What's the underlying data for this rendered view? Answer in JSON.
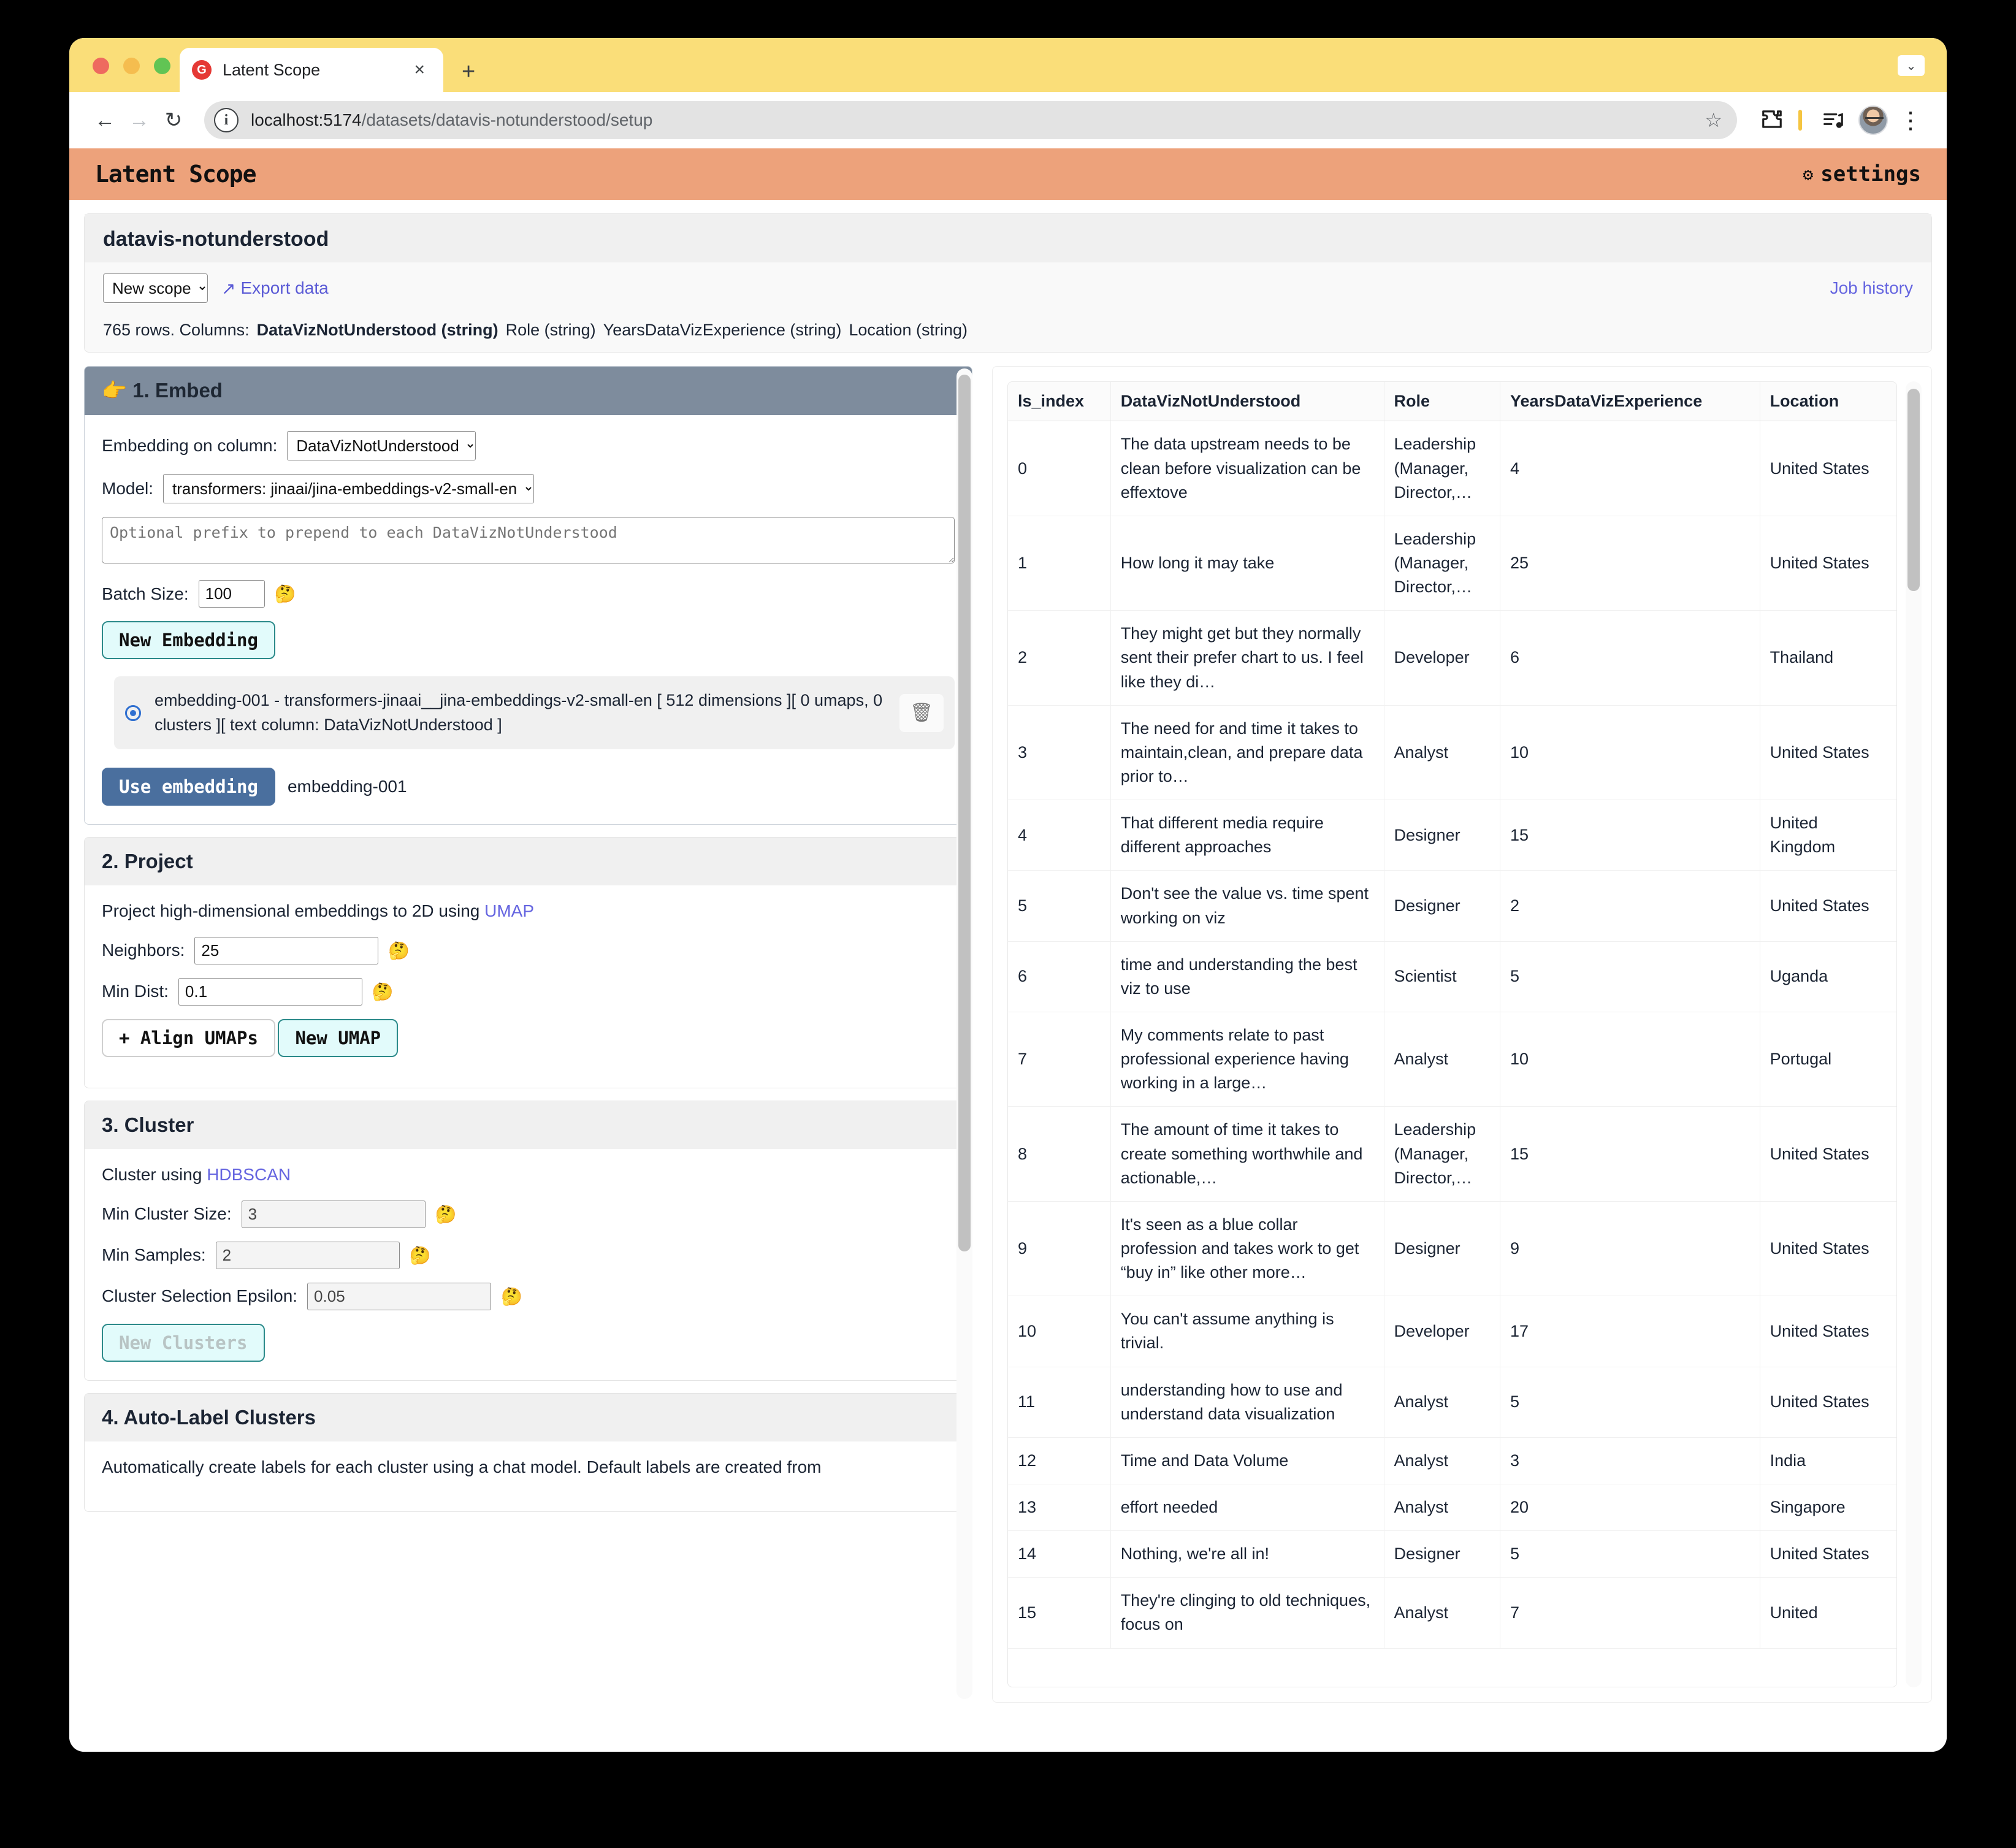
{
  "browser": {
    "tab": {
      "title": "Latent Scope",
      "favicon_letter": "G"
    },
    "new_tab_label": "+",
    "close_label": "×",
    "tabstrip_caret": "⌄",
    "back_label": "←",
    "forward_label": "→",
    "reload_label": "↻",
    "info_label": "i",
    "url_prefix": "localhost:5174",
    "url_path": "/datasets/datavis-notunderstood/setup",
    "star_label": "☆",
    "extensions_icon": "puzzle-icon",
    "media_icon": "media-list-icon",
    "menu_label": "⋮"
  },
  "app": {
    "brand": "Latent Scope",
    "settings_label": "settings",
    "gear_glyph": "⚙"
  },
  "dataset": {
    "title": "datavis-notunderstood",
    "scope_select_value": "New scope",
    "scope_options": [
      "New scope"
    ],
    "export_label": "Export data",
    "export_glyph": "↗",
    "job_history_label": "Job history",
    "rows_text": "765 rows. Columns:",
    "columns": [
      {
        "name": "DataVizNotUnderstood (string)",
        "bold": true
      },
      {
        "name": "Role (string)",
        "bold": false
      },
      {
        "name": "YearsDataVizExperience (string)",
        "bold": false
      },
      {
        "name": "Location (string)",
        "bold": false
      }
    ]
  },
  "embed": {
    "heading": "👉 1. Embed",
    "column_label": "Embedding on column:",
    "column_value": "DataVizNotUnderstood",
    "model_label": "Model:",
    "model_value": "transformers: jinaai/jina-embeddings-v2-small-en",
    "prefix_placeholder": "Optional prefix to prepend to each DataVizNotUnderstood",
    "prefix_value": "",
    "batch_label": "Batch Size:",
    "batch_value": "100",
    "help_glyph": "🤔",
    "new_embedding_label": "New Embedding",
    "embedding_item": "embedding-001 - transformers-jinaai__jina-embeddings-v2-small-en [ 512 dimensions ][ 0 umaps,  0 clusters ][ text column: DataVizNotUnderstood ]",
    "trash_glyph": "🗑",
    "use_embedding_label": "Use embedding",
    "use_embedding_value": "embedding-001"
  },
  "project": {
    "heading": "2. Project",
    "description_prefix": "Project high-dimensional embeddings to 2D using ",
    "description_link": "UMAP",
    "neighbors_label": "Neighbors:",
    "neighbors_value": "25",
    "mindist_label": "Min Dist:",
    "mindist_value": "0.1",
    "align_umaps_label": "+ Align UMAPs",
    "new_umap_label": "New UMAP"
  },
  "cluster": {
    "heading": "3. Cluster",
    "description_prefix": "Cluster using ",
    "description_link": "HDBSCAN",
    "min_cluster_size_label": "Min Cluster Size:",
    "min_cluster_size_value": "3",
    "min_samples_label": "Min Samples:",
    "min_samples_value": "2",
    "epsilon_label": "Cluster Selection Epsilon:",
    "epsilon_value": "0.05",
    "new_clusters_label": "New Clusters"
  },
  "autolabel": {
    "heading": "4. Auto-Label Clusters",
    "description": "Automatically create labels for each cluster using a chat model. Default labels are created from"
  },
  "table": {
    "headers": [
      "ls_index",
      "DataVizNotUnderstood",
      "Role",
      "YearsDataVizExperience",
      "Location"
    ],
    "rows": [
      [
        "0",
        "The data upstream needs to be clean before visualization can be effextove",
        "Leadership (Manager, Director,…",
        "4",
        "United States"
      ],
      [
        "1",
        "How long it may take",
        "Leadership (Manager, Director,…",
        "25",
        "United States"
      ],
      [
        "2",
        "They might get but they normally sent their prefer chart to us. I feel like they di…",
        "Developer",
        "6",
        "Thailand"
      ],
      [
        "3",
        "The need for and time it takes to maintain,clean, and prepare data prior to…",
        "Analyst",
        "10",
        "United States"
      ],
      [
        "4",
        "That different media require different approaches",
        "Designer",
        "15",
        "United Kingdom"
      ],
      [
        "5",
        "Don't see the value vs. time spent working on viz",
        "Designer",
        "2",
        "United States"
      ],
      [
        "6",
        "time and understanding the best viz to use",
        "Scientist",
        "5",
        "Uganda"
      ],
      [
        "7",
        "My comments relate to past professional experience having working in a large…",
        "Analyst",
        "10",
        "Portugal"
      ],
      [
        "8",
        "The amount of time it takes to create something worthwhile and actionable,…",
        "Leadership (Manager, Director,…",
        "15",
        "United States"
      ],
      [
        "9",
        "It's seen as a blue collar profession and takes work to get “buy in” like other more…",
        "Designer",
        "9",
        "United States"
      ],
      [
        "10",
        "You can't assume anything is trivial.",
        "Developer",
        "17",
        "United States"
      ],
      [
        "11",
        "understanding how to use and understand data visualization",
        "Analyst",
        "5",
        "United States"
      ],
      [
        "12",
        "Time and Data Volume",
        "Analyst",
        "3",
        "India"
      ],
      [
        "13",
        "effort needed",
        "Analyst",
        "20",
        "Singapore"
      ],
      [
        "14",
        "Nothing, we're all in!",
        "Designer",
        "5",
        "United States"
      ],
      [
        "15",
        "They're clinging to old techniques, focus on",
        "Analyst",
        "7",
        "United"
      ]
    ]
  },
  "colors": {
    "app_header": "#eda27b",
    "tabstrip": "#fade79",
    "embed_header": "#7e8c9d",
    "accent_link": "#6565e0",
    "button_teal_border": "#2b8a8a",
    "button_blue": "#4a6f9e"
  }
}
